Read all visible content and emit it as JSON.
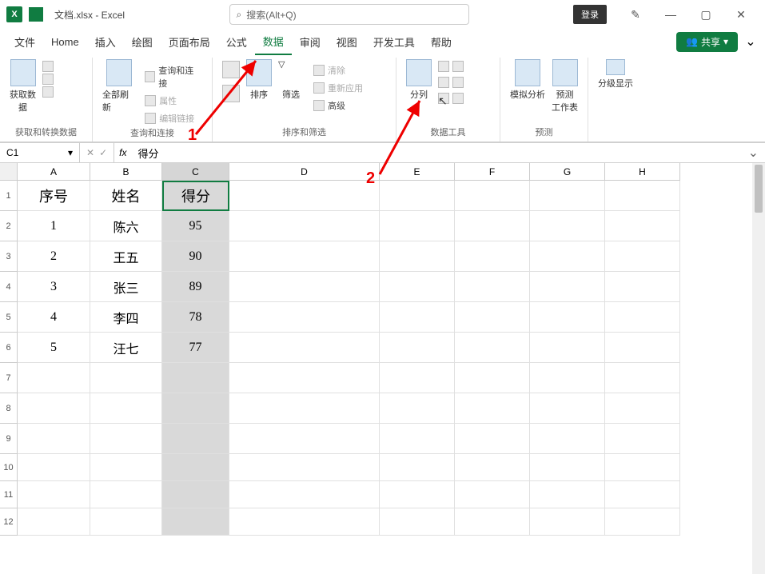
{
  "titlebar": {
    "doc_title": "文档.xlsx - Excel",
    "search_placeholder": "搜索(Alt+Q)",
    "login_label": "登录"
  },
  "menu": {
    "tabs": [
      "文件",
      "Home",
      "插入",
      "绘图",
      "页面布局",
      "公式",
      "数据",
      "审阅",
      "视图",
      "开发工具",
      "帮助"
    ],
    "active_index": 6,
    "share_label": "共享"
  },
  "ribbon": {
    "group1": {
      "label": "获取和转换数据",
      "item1": "获取数\n据"
    },
    "group2": {
      "label": "查询和连接",
      "item1": "全部刷新",
      "sub1": "查询和连接",
      "sub2": "属性",
      "sub3": "编辑链接"
    },
    "group3": {
      "label": "排序和筛选",
      "item1": "排序",
      "item2": "筛选",
      "sub1": "清除",
      "sub2": "重新应用",
      "sub3": "高级"
    },
    "group4": {
      "label": "数据工具",
      "item1": "分列"
    },
    "group5": {
      "label": "预测",
      "item1": "模拟分析",
      "item2": "预测\n工作表"
    },
    "group6": {
      "label": "",
      "item1": "分级显示"
    }
  },
  "formula": {
    "name": "C1",
    "value": "得分"
  },
  "grid": {
    "cols": [
      "A",
      "B",
      "C",
      "D",
      "E",
      "F",
      "G",
      "H"
    ],
    "rows": [
      "1",
      "2",
      "3",
      "4",
      "5",
      "6",
      "7",
      "8",
      "9",
      "10",
      "11",
      "12"
    ],
    "data": [
      [
        "序号",
        "姓名",
        "得分"
      ],
      [
        "1",
        "陈六",
        "95"
      ],
      [
        "2",
        "王五",
        "90"
      ],
      [
        "3",
        "张三",
        "89"
      ],
      [
        "4",
        "李四",
        "78"
      ],
      [
        "5",
        "汪七",
        "77"
      ]
    ]
  },
  "annotations": {
    "label1": "1",
    "label2": "2"
  }
}
